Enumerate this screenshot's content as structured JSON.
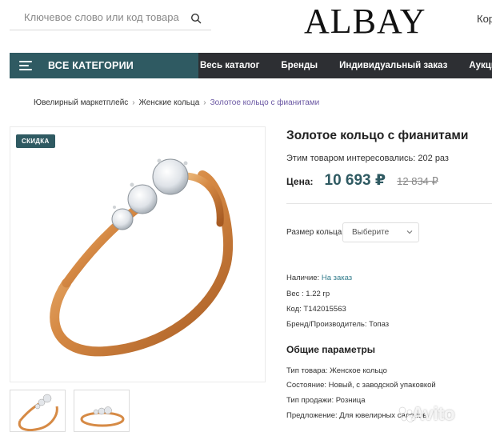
{
  "header": {
    "search_placeholder": "Ключевое слово или код товара",
    "logo": "ALBAY",
    "cart_partial": "Кор"
  },
  "nav": {
    "categories_label": "ВСЕ КАТЕГОРИИ",
    "items": [
      "Весь каталог",
      "Бренды",
      "Индивидуальный заказ",
      "Аукционы"
    ]
  },
  "breadcrumb": {
    "items": [
      "Ювелирный маркетплейс",
      "Женские кольца"
    ],
    "current": "Золотое кольцо с фианитами"
  },
  "product": {
    "badge": "СКИДКА",
    "title": "Золотое кольцо с фианитами",
    "interest": "Этим товаром интересовались: 202 раз",
    "price_label": "Цена:",
    "price": "10 693 ₽",
    "old_price": "12 834 ₽",
    "size_label": "Размер кольца",
    "size_select": "Выберите",
    "availability_label": "Наличие:",
    "availability_value": "На заказ",
    "weight": "Вес : 1.22 гр",
    "code": "Код: Т142015563",
    "brand": "Бренд/Производитель: Топаз",
    "params_title": "Общие параметры",
    "params": [
      "Тип товара: Женское кольцо",
      "Состояние: Новый, с заводской упаковкой",
      "Тип продажи: Розница",
      "Предложение: Для ювелирных салонов"
    ]
  },
  "watermark": "Avito",
  "colors": {
    "accent": "#2f5a62",
    "navbar": "#2d2f33",
    "price": "#2f5a62",
    "link": "#2f7a8a",
    "breadcrumb_current": "#6a57a3"
  }
}
